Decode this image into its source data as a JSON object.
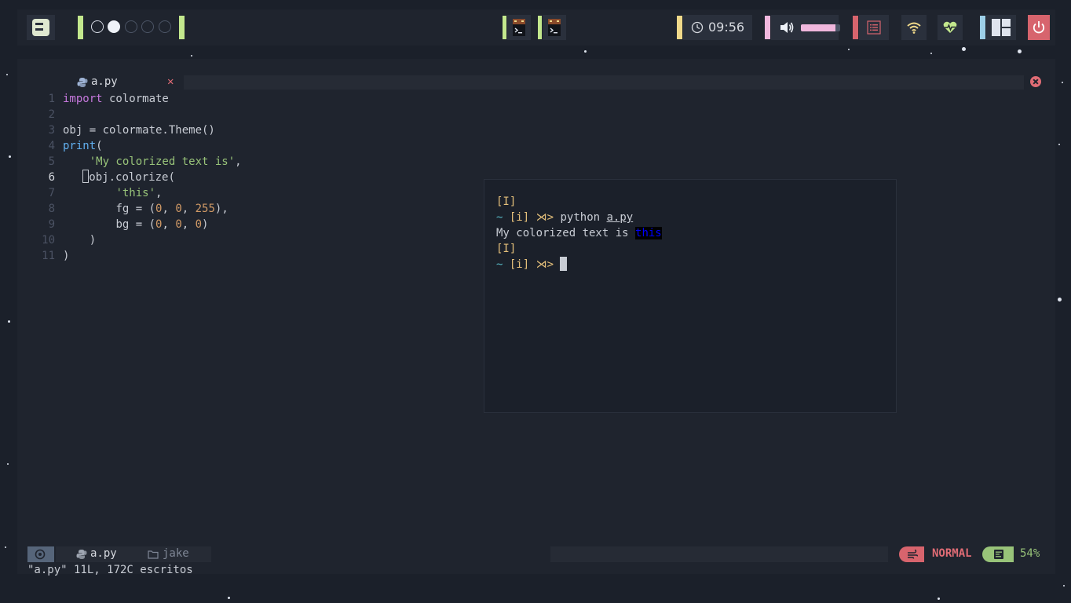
{
  "topbar": {
    "clock": {
      "time": "09:56",
      "icon": "clock-icon"
    },
    "volume": {
      "level_percent": 88,
      "icon": "speaker-icon"
    },
    "workspaces": [
      {
        "state": "active-partial"
      },
      {
        "state": "occupied"
      },
      {
        "state": "empty"
      },
      {
        "state": "empty"
      },
      {
        "state": "empty"
      }
    ],
    "colors": {
      "accent_green": "#c3e88d",
      "accent_yellow": "#f0d98a",
      "accent_pink": "#f0b7dd",
      "accent_red": "#d7646d",
      "accent_blue": "#9ccfe8"
    }
  },
  "editor": {
    "tab": {
      "label": "a.py",
      "close_glyph": "✕"
    },
    "lines": [
      {
        "n": "1"
      },
      {
        "n": "2"
      },
      {
        "n": "3"
      },
      {
        "n": "4"
      },
      {
        "n": "5"
      },
      {
        "n": "6"
      },
      {
        "n": "7"
      },
      {
        "n": "8"
      },
      {
        "n": "9"
      },
      {
        "n": "10"
      },
      {
        "n": "11"
      }
    ],
    "tokens": {
      "l1_kw": "import",
      "l1_id": " colormate",
      "l3": "obj = colormate.Theme()",
      "l4_fn": "print",
      "l4_p": "(",
      "l5_str": "'My colorized text is'",
      "l5_p": ",",
      "l6": "obj.colorize(",
      "l7_str": "'this'",
      "l7_p": ",",
      "l8_a": "fg = (",
      "l8_n1": "0",
      "l8_c1": ", ",
      "l8_n2": "0",
      "l8_c2": ", ",
      "l8_n3": "255",
      "l8_e": "),",
      "l9_a": "bg = (",
      "l9_n1": "0",
      "l9_c1": ", ",
      "l9_n2": "0",
      "l9_c2": ", ",
      "l9_n3": "0",
      "l9_e": ")",
      "l10": ")",
      "l11": ")"
    }
  },
  "terminal": {
    "mode1": "[I]",
    "prompt1": {
      "tilde": "~",
      "bracket": "[i]",
      "arrow": "⋊>",
      "cmd": "python",
      "arg": "a.py"
    },
    "output": {
      "text": "My colorized text is",
      "highlight": "this"
    },
    "mode2": "[I]",
    "prompt2": {
      "tilde": "~",
      "bracket": "[i]",
      "arrow": "⋊>"
    }
  },
  "statusline": {
    "file": "a.py",
    "dir": "jake",
    "mode": "NORMAL",
    "percent": "54%"
  },
  "message": "\"a.py\" 11L, 172C escritos"
}
